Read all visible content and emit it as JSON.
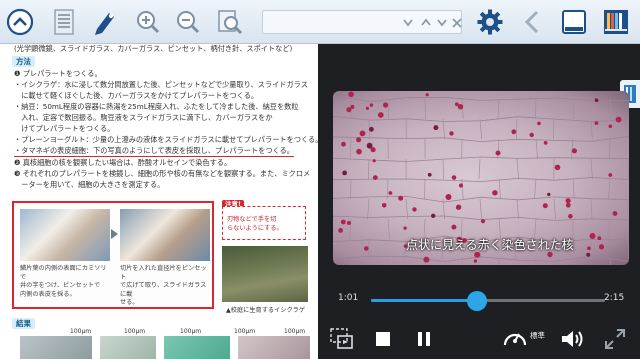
{
  "toolbar": {
    "buttons": [
      {
        "name": "collapse-up-icon"
      },
      {
        "name": "page-list-icon"
      },
      {
        "name": "marker-pen-icon"
      },
      {
        "name": "zoom-in-icon"
      },
      {
        "name": "zoom-out-icon"
      },
      {
        "name": "zoom-page-icon"
      },
      {
        "name": "search-dropdown-icon"
      },
      {
        "name": "search-prev-icon"
      },
      {
        "name": "search-next-icon"
      },
      {
        "name": "search-close-icon"
      },
      {
        "name": "settings-gear-icon"
      },
      {
        "name": "back-chevron-icon"
      },
      {
        "name": "window-icon"
      },
      {
        "name": "bookshelf-icon"
      }
    ],
    "search_placeholder": ""
  },
  "document": {
    "top_line": "(光学顕微鏡、スライドガラス、カバーガラス、ピンセット、柄付き針、スポイトなど)",
    "method_head": "方法",
    "step1": "❶ プレパラートをつくる。",
    "lines": [
      "・イシクラゲ：水に浸して数分間放置した後、ピンセットなどで少量取り、スライドガラス",
      "　に載せて軽くほぐした後、カバーガラスをかけてプレパラートをつくる。",
      "・納豆：50mL程度の容器に熱湯を25mL程度入れ、ふたをして冷ました後、納豆を数粒",
      "　入れ、定容で数回振る。駒豆液をスライドガラスに滴下し、カバーガラスをか",
      "　けてプレパラートをつくる。",
      "・プレーンヨーグルト：少量の上澄みの液体をスライドガラスに載せてプレパラートをつくる。",
      "・タマネギの表皮細胞：下の写真のようにして表皮を採取し、プレパラートをつくる。",
      "❷ 真核細胞の核を観察したい場合は、酢酸オルセインで染色する。",
      "❸ それぞれのプレパラートを検鏡し、細胞の形や核の有無などを観察する。また、ミクロメ",
      "　ーターを用いて、細胞の大きさを測定する。"
    ],
    "caption_a": "鱗片葉の内側の表面にカミソリで\n井の字をつけ、ピンセットで\n内側の表皮を採る。",
    "caption_b": "切片を入れた直径片をピンセット\nで広げて取り、スライドガラスに載\nせる。",
    "note_tag": "注意!",
    "note_text": "刃物などで手を切\nらないようにする。",
    "field_caption": "▲校庭に生育するイシクラゲ",
    "result_head": "結果",
    "scales": [
      "100μm",
      "100μm",
      "100μm",
      "100μm",
      "100μm"
    ]
  },
  "video": {
    "subtitle": "点状に見える赤く染色された核",
    "time_current": "1:01",
    "time_total": "2:15",
    "progress_fraction": 0.4519,
    "speed_label": "標準",
    "controls": [
      "stop-icon",
      "pause-icon",
      "speed-gauge-icon",
      "volume-icon",
      "fullscreen-icon",
      "picture-in-picture-icon"
    ]
  },
  "colors": {
    "accent": "#2da6e8",
    "toolbar_icon": "#1e4f8a",
    "underline_red": "#d6262d",
    "video_bg": "#1d1f22"
  }
}
